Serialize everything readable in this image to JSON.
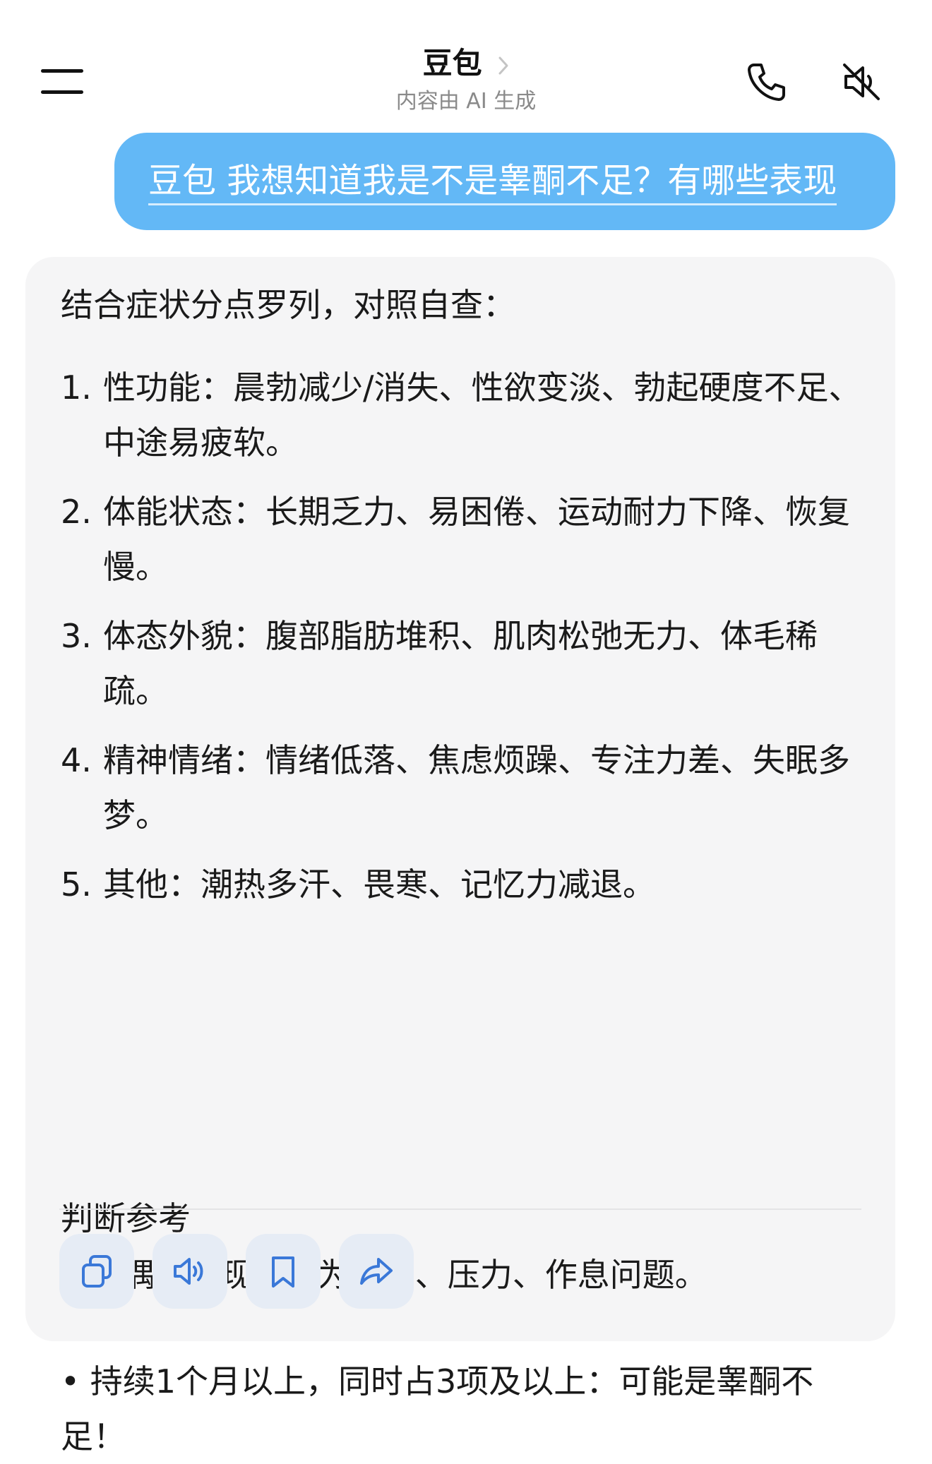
{
  "header": {
    "title": "豆包",
    "subtitle": "内容由 AI 生成",
    "icons": [
      "menu-icon",
      "chevron-right-icon",
      "phone-icon",
      "speaker-mute-icon"
    ]
  },
  "user_message": {
    "text": "豆包 我想知道我是不是睾酮不足？有哪些表现"
  },
  "reply": {
    "intro": "结合症状分点罗列，对照自查：",
    "items": [
      {
        "num": "1.",
        "text": "性功能：晨勃减少/消失、性欲变淡、勃起硬度不足、中途易疲软。"
      },
      {
        "num": "2.",
        "text": "体能状态：长期乏力、易困倦、运动耐力下降、恢复慢。"
      },
      {
        "num": "3.",
        "text": "体态外貌：腹部脂肪堆积、肌肉松弛无力、体毛稀疏。"
      },
      {
        "num": "4.",
        "text": "精神情绪：情绪低落、焦虑烦躁、专注力差、失眠多梦。"
      },
      {
        "num": "5.",
        "text": "其他：潮热多汗、畏寒、记忆力减退。"
      }
    ],
    "reference_title": "判断参考",
    "bullets": [
      "• 仅偶尔出现：多为劳累、压力、作息问题。",
      "• 持续1个月以上，同时占3项及以上：可能是睾酮不足！"
    ]
  },
  "actions": [
    {
      "name": "copy",
      "icon": "copy-icon"
    },
    {
      "name": "read-aloud",
      "icon": "speaker-icon"
    },
    {
      "name": "bookmark",
      "icon": "bookmark-icon"
    },
    {
      "name": "share",
      "icon": "share-icon"
    }
  ],
  "colors": {
    "user_bubble": "#63b8f6",
    "card_background": "#f5f5f6",
    "action_button": "#e6ecf5",
    "action_icon": "#3a78d8"
  }
}
